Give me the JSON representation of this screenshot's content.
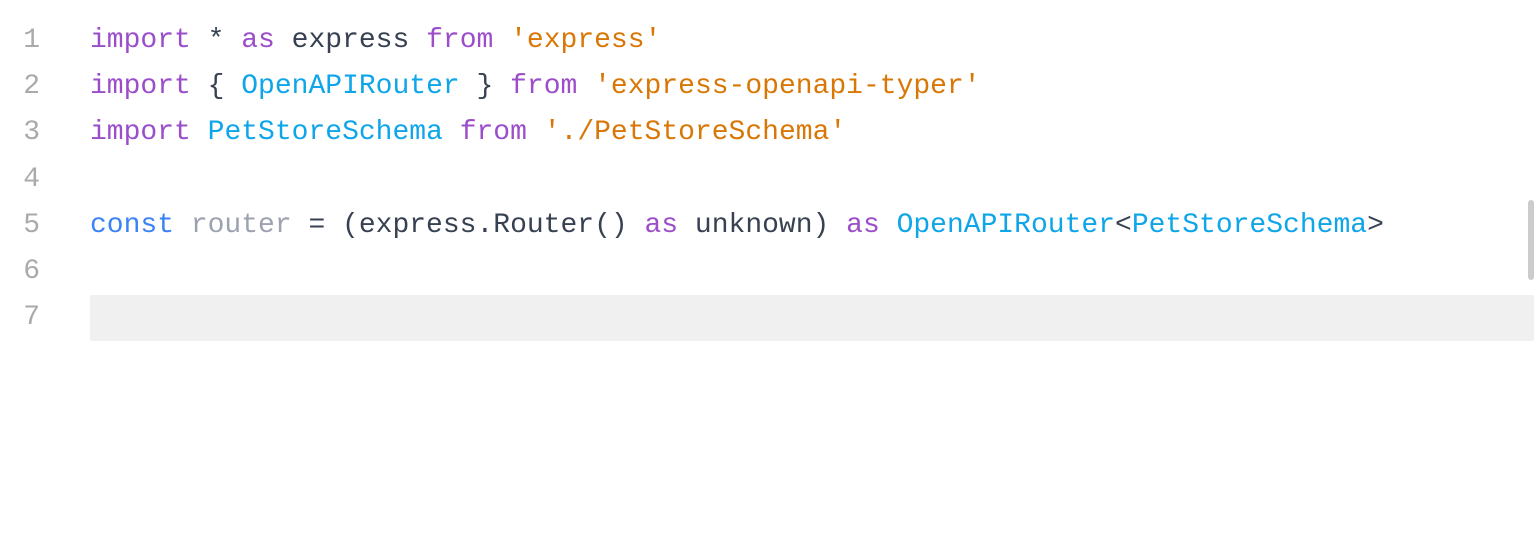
{
  "editor": {
    "lines": [
      {
        "number": "1",
        "tokens": [
          {
            "text": "import",
            "class": "kw-import"
          },
          {
            "text": " * ",
            "class": "plain"
          },
          {
            "text": "as",
            "class": "kw-as"
          },
          {
            "text": " express ",
            "class": "plain"
          },
          {
            "text": "from",
            "class": "kw-from"
          },
          {
            "text": " 'express'",
            "class": "str"
          }
        ],
        "active": false
      },
      {
        "number": "2",
        "tokens": [
          {
            "text": "import",
            "class": "kw-import"
          },
          {
            "text": " { ",
            "class": "plain"
          },
          {
            "text": "OpenAPIRouter",
            "class": "identifier"
          },
          {
            "text": " } ",
            "class": "plain"
          },
          {
            "text": "from",
            "class": "kw-from"
          },
          {
            "text": " 'express-openapi-typer'",
            "class": "str"
          }
        ],
        "active": false
      },
      {
        "number": "3",
        "tokens": [
          {
            "text": "import",
            "class": "kw-import"
          },
          {
            "text": " ",
            "class": "plain"
          },
          {
            "text": "PetStoreSchema",
            "class": "identifier"
          },
          {
            "text": " ",
            "class": "plain"
          },
          {
            "text": "from",
            "class": "kw-from"
          },
          {
            "text": " './PetStoreSchema'",
            "class": "str"
          }
        ],
        "active": false
      },
      {
        "number": "4",
        "tokens": [],
        "active": false
      },
      {
        "number": "5",
        "tokens": [
          {
            "text": "const",
            "class": "kw-const"
          },
          {
            "text": " router ",
            "class": "var-name"
          },
          {
            "text": "= (express.Router() ",
            "class": "plain"
          },
          {
            "text": "as",
            "class": "kw-as"
          },
          {
            "text": " unknown) ",
            "class": "plain"
          },
          {
            "text": "as",
            "class": "kw-as"
          },
          {
            "text": " ",
            "class": "plain"
          },
          {
            "text": "OpenAPIRouter",
            "class": "type-name"
          },
          {
            "text": "<",
            "class": "plain"
          },
          {
            "text": "PetStoreSchema",
            "class": "type-name"
          },
          {
            "text": ">",
            "class": "plain"
          }
        ],
        "active": false
      },
      {
        "number": "6",
        "tokens": [],
        "active": false
      },
      {
        "number": "7",
        "tokens": [],
        "active": true
      }
    ]
  }
}
